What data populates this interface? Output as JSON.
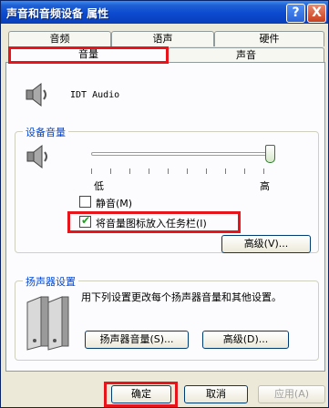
{
  "window": {
    "title": "声音和音频设备 属性"
  },
  "title_buttons": {
    "help": "?",
    "close": "X"
  },
  "tabs": {
    "row_top": [
      "音频",
      "语声",
      "硬件"
    ],
    "row_bottom": [
      "音量",
      "声音"
    ],
    "active": "音量"
  },
  "device": {
    "name": "IDT Audio"
  },
  "device_volume": {
    "group_title": "设备音量",
    "slider_low_label": "低",
    "slider_high_label": "高",
    "slider_level": 1.0,
    "mute_label": "静音(M)",
    "mute_checked": false,
    "taskbar_icon_label": "将音量图标放入任务栏(I)",
    "taskbar_icon_checked": true,
    "advanced_button": "高级(V)..."
  },
  "speaker_settings": {
    "group_title": "扬声器设置",
    "description": "用下列设置更改每个扬声器音量和其他设置。",
    "speaker_volume_button": "扬声器音量(S)...",
    "advanced_button": "高级(D)..."
  },
  "footer": {
    "ok_button": "确定",
    "cancel_button": "取消",
    "apply_button": "应用(A)"
  },
  "colors": {
    "accent_highlight": "#e8141b",
    "group_title": "#0046d5",
    "titlebar": "#0b4ad0"
  }
}
